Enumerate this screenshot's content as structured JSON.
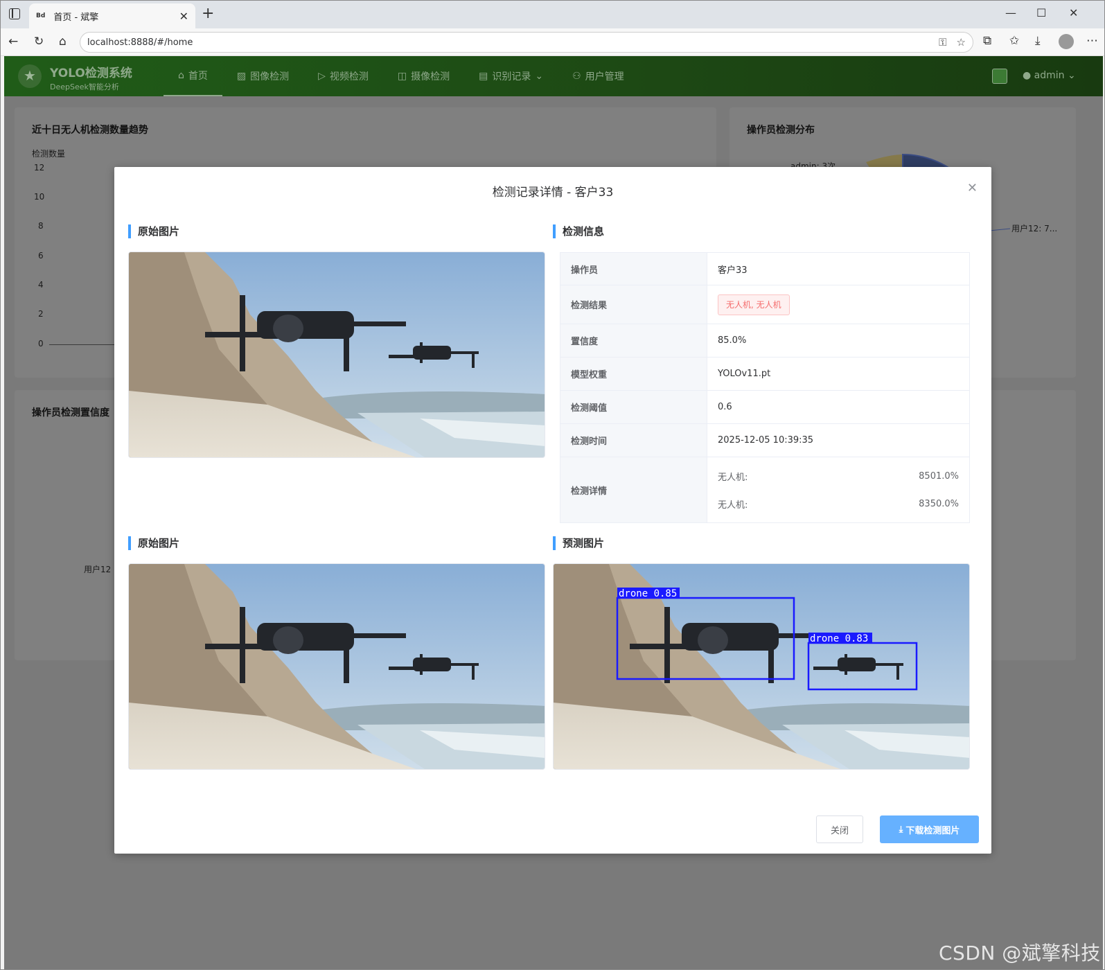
{
  "browser": {
    "tab_favicon": "Bd",
    "tab_title": "首页 - 斌擎",
    "url": "localhost:8888/#/home",
    "icons": [
      "sidebar-icon",
      "close-icon",
      "plus-icon",
      "minimize-icon",
      "maximize-icon",
      "window-close-icon",
      "back-icon",
      "reload-icon",
      "home-icon",
      "info-icon",
      "key-icon",
      "star-icon",
      "extensions-icon",
      "favorites-icon",
      "download-icon",
      "profile-icon",
      "more-icon"
    ]
  },
  "app": {
    "brand_title": "YOLO检测系统",
    "brand_subtitle": "DeepSeek智能分析",
    "logo_icon": "★",
    "menu": [
      {
        "label": "首页",
        "icon": "home-icon",
        "active": true
      },
      {
        "label": "图像检测",
        "icon": "image-icon"
      },
      {
        "label": "视频检测",
        "icon": "play-icon"
      },
      {
        "label": "摄像检测",
        "icon": "camera-icon"
      },
      {
        "label": "识别记录",
        "icon": "document-icon",
        "dropdown": true
      },
      {
        "label": "用户管理",
        "icon": "user-icon"
      }
    ],
    "user": "admin"
  },
  "dashboard": {
    "trend_title": "近十日无人机检测数量趋势",
    "trend_ylabel": "检测数量",
    "trend_ticks": [
      "12",
      "10",
      "8",
      "6",
      "4",
      "2",
      "0"
    ],
    "pie_title": "操作员检测分布",
    "pie_label_admin": "admin: 3次",
    "pie_label_user12": "用户12: 7...",
    "conf_title": "操作员检测置信度",
    "conf_label": "用户12"
  },
  "modal": {
    "title": "检测记录详情 - 客户33",
    "sec_original_top": "原始图片",
    "sec_info": "检测信息",
    "sec_original_bottom": "原始图片",
    "sec_predicted": "预测图片",
    "rows": {
      "operator_label": "操作员",
      "operator": "客户33",
      "result_label": "检测结果",
      "result_tag": "无人机, 无人机",
      "confidence_label": "置信度",
      "confidence": "85.0%",
      "model_label": "模型权重",
      "model": "YOLOv11.pt",
      "threshold_label": "检测阈值",
      "threshold": "0.6",
      "time_label": "检测时间",
      "time": "2025-12-05 10:39:35",
      "details_label": "检测详情",
      "details": [
        {
          "name": "无人机:",
          "value": "8501.0%"
        },
        {
          "name": "无人机:",
          "value": "8350.0%"
        }
      ]
    },
    "detections": [
      {
        "label": "drone 0.85"
      },
      {
        "label": "drone 0.83"
      }
    ],
    "close_button": "关闭",
    "download_button": "下载检测图片",
    "accent": "#409eff",
    "box_color": "#1a1aff"
  },
  "watermark": "CSDN @斌擎科技"
}
